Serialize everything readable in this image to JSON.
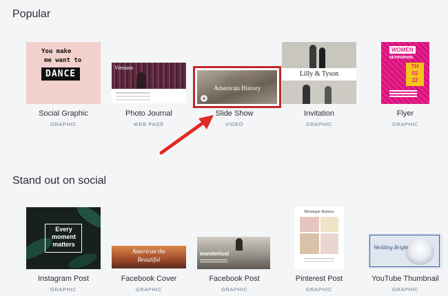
{
  "sections": [
    {
      "title": "Popular",
      "items": [
        {
          "label": "Social Graphic",
          "type": "GRAPHIC"
        },
        {
          "label": "Photo Journal",
          "type": "WEB PAGE"
        },
        {
          "label": "Slide Show",
          "type": "VIDEO"
        },
        {
          "label": "Invitation",
          "type": "GRAPHIC"
        },
        {
          "label": "Flyer",
          "type": "GRAPHIC"
        }
      ]
    },
    {
      "title": "Stand out on social",
      "items": [
        {
          "label": "Instagram Post",
          "type": "GRAPHIC"
        },
        {
          "label": "Facebook Cover",
          "type": "GRAPHIC"
        },
        {
          "label": "Facebook Post",
          "type": "GRAPHIC"
        },
        {
          "label": "Pinterest Post",
          "type": "GRAPHIC"
        },
        {
          "label": "YouTube Thumbnail",
          "type": "GRAPHIC"
        }
      ]
    }
  ],
  "thumbs": {
    "social_graphic": {
      "line1": "You make",
      "line2": "me want to",
      "line3": "DANCE"
    },
    "photo_journal": {
      "title": "Vietnam"
    },
    "slide_show": {
      "title": "American History"
    },
    "invitation": {
      "names": "Lilly & Tyson"
    },
    "flyer": {
      "title": "WOMEN",
      "subtitle": "NETWORKING",
      "date_top": "TH",
      "date_mid": "02",
      "date_bot": "22"
    },
    "instagram_post": {
      "line1": "Every",
      "line2": "moment",
      "line3": "matters"
    },
    "facebook_cover": {
      "line1": "American the",
      "line2": "Beautiful"
    },
    "facebook_post": {
      "title": "wanderlust"
    },
    "pinterest_post": {
      "title": "Monique Ramos"
    },
    "youtube_thumbnail": {
      "title": "Wedding Bright"
    }
  },
  "colors": {
    "highlight": "#c0262b",
    "arrow": "#e02a26",
    "flyer_pink": "#e91e8c",
    "flyer_yellow": "#f5c518",
    "social_bg": "#f2d0cc"
  }
}
